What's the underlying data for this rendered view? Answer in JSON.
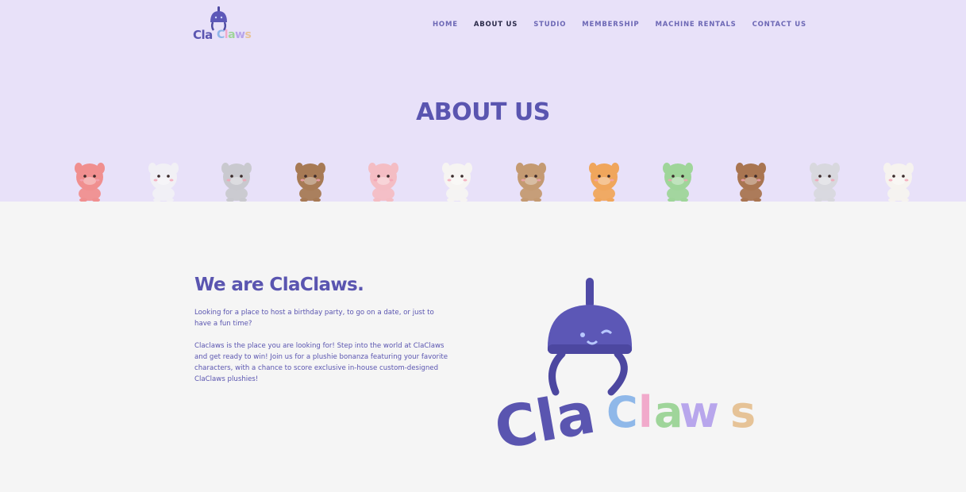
{
  "logo": {
    "cla": "Cla",
    "claws": [
      "C",
      "l",
      "a",
      "w",
      "s"
    ]
  },
  "nav": {
    "items": [
      "HOME",
      "ABOUT US",
      "STUDIO",
      "MEMBERSHIP",
      "MACHINE RENTALS",
      "CONTACT US"
    ],
    "active": "ABOUT US"
  },
  "hero": {
    "title": "ABOUT US"
  },
  "animals": [
    {
      "name": "dragon",
      "color": "#f08f8f"
    },
    {
      "name": "rabbit",
      "color": "#f1f0f5"
    },
    {
      "name": "rat",
      "color": "#c9c9cf"
    },
    {
      "name": "dog",
      "color": "#a77a55"
    },
    {
      "name": "pig",
      "color": "#f4bdc4"
    },
    {
      "name": "cow",
      "color": "#f6f4f2"
    },
    {
      "name": "monkey",
      "color": "#c49a72"
    },
    {
      "name": "tiger",
      "color": "#f0a65c"
    },
    {
      "name": "snake",
      "color": "#9fd59a"
    },
    {
      "name": "horse",
      "color": "#a97551"
    },
    {
      "name": "goat",
      "color": "#d8d8de"
    },
    {
      "name": "rooster",
      "color": "#f6f3ef"
    }
  ],
  "about": {
    "heading": "We are ClaClaws.",
    "para1": "Looking for a place to host a birthday party, to go on a date, or just to have a fun time?",
    "para2": "Claclaws is the place you are looking for! Step into the world at ClaClaws and get ready to win! Join us for a plushie bonanza featuring your favorite characters, with a chance to score exclusive in-house custom-designed ClaClaws plushies!"
  },
  "big_logo": {
    "cla": "Cla",
    "claws": [
      "C",
      "l",
      "a",
      "w",
      "s"
    ]
  }
}
